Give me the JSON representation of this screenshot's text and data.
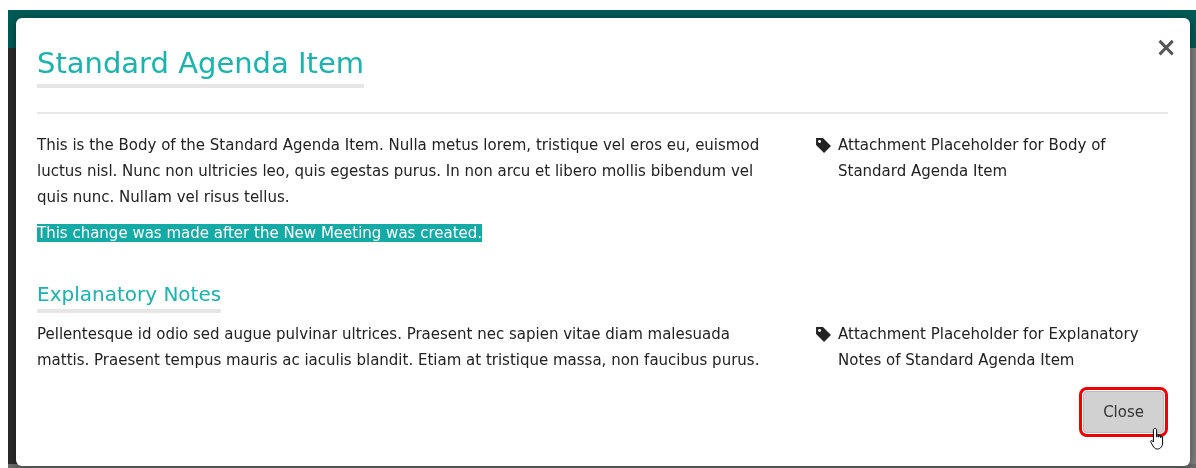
{
  "dialog": {
    "title": "Standard Agenda Item",
    "close_glyph": "×",
    "body": {
      "paragraphs": [
        {
          "text": "This is the Body of the Standard Agenda Item. Nulla metus lorem, tristique vel eros eu, euismod luctus nisl. Nunc non ultricies leo, quis egestas purus. In non arcu et libero mollis bibendum vel quis nunc. Nullam vel risus tellus.",
          "highlighted": false
        },
        {
          "text": "This change was made after the New Meeting was created.",
          "highlighted": true
        }
      ],
      "attachment": "Attachment Placeholder for Body of Standard Agenda Item"
    },
    "notes": {
      "heading": "Explanatory Notes",
      "paragraphs": [
        {
          "text": "Pellentesque id odio sed augue pulvinar ultrices. Praesent nec sapien vitae diam malesuada mattis. Praesent tempus mauris ac iaculis blandit. Etiam at tristique massa, non faucibus purus.",
          "highlighted": false
        }
      ],
      "attachment": "Attachment Placeholder for Explanatory Notes of Standard Agenda Item"
    },
    "buttons": [
      {
        "label": "Close",
        "focused": true
      }
    ]
  }
}
